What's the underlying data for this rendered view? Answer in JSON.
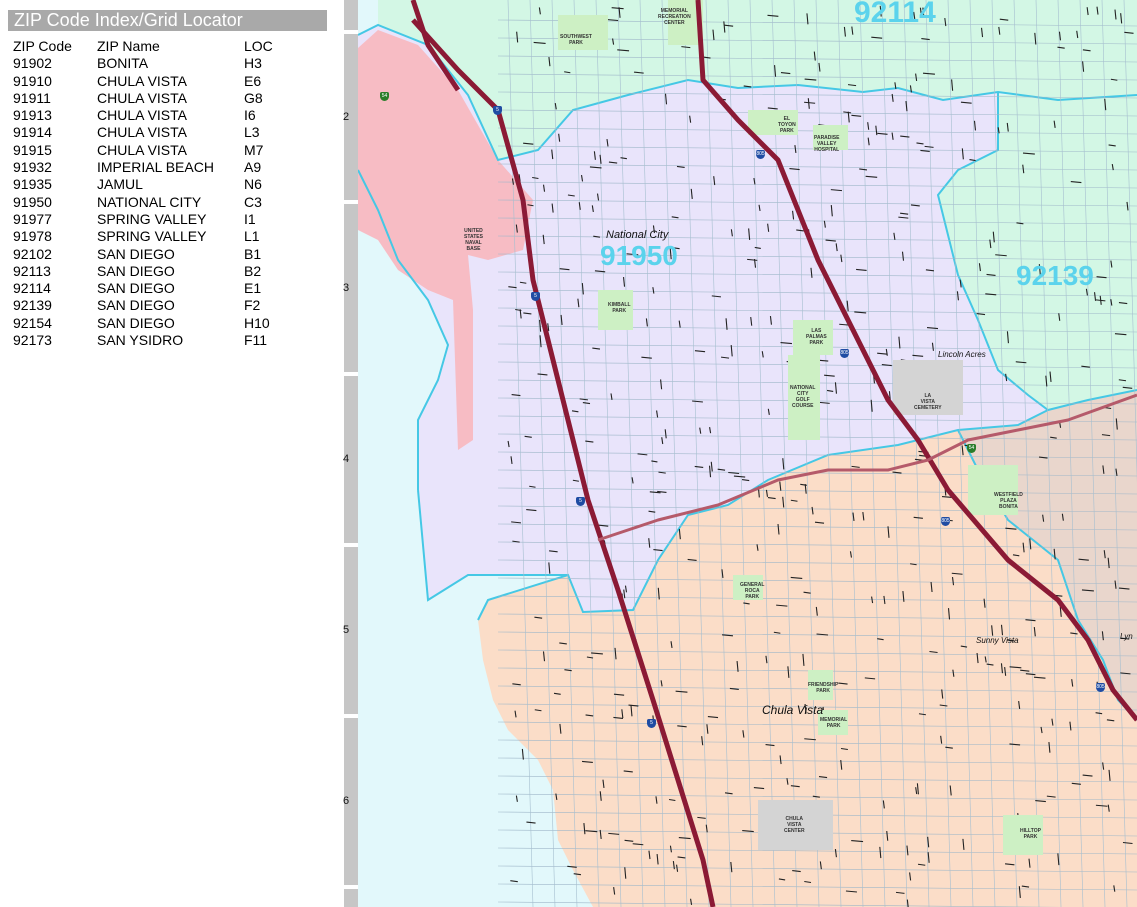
{
  "index": {
    "title": "ZIP Code Index/Grid Locator",
    "headers": [
      "ZIP Code",
      "ZIP Name",
      "LOC"
    ],
    "rows": [
      [
        "91902",
        "BONITA",
        "H3"
      ],
      [
        "91910",
        "CHULA VISTA",
        "E6"
      ],
      [
        "91911",
        "CHULA VISTA",
        "G8"
      ],
      [
        "91913",
        "CHULA VISTA",
        "I6"
      ],
      [
        "91914",
        "CHULA VISTA",
        "L3"
      ],
      [
        "91915",
        "CHULA VISTA",
        "M7"
      ],
      [
        "91932",
        "IMPERIAL BEACH",
        "A9"
      ],
      [
        "91935",
        "JAMUL",
        "N6"
      ],
      [
        "91950",
        "NATIONAL CITY",
        "C3"
      ],
      [
        "91977",
        "SPRING VALLEY",
        "I1"
      ],
      [
        "91978",
        "SPRING VALLEY",
        "L1"
      ],
      [
        "92102",
        "SAN DIEGO",
        "B1"
      ],
      [
        "92113",
        "SAN DIEGO",
        "B2"
      ],
      [
        "92114",
        "SAN DIEGO",
        "E1"
      ],
      [
        "92139",
        "SAN DIEGO",
        "F2"
      ],
      [
        "92154",
        "SAN DIEGO",
        "H10"
      ],
      [
        "92173",
        "SAN YSIDRO",
        "F11"
      ]
    ]
  },
  "grid_rows": [
    "2",
    "3",
    "4",
    "5",
    "6"
  ],
  "map": {
    "zip_labels": [
      "92114",
      "91950",
      "92139"
    ],
    "places": [
      "National City",
      "Lincoln Acres",
      "Sunny Vista",
      "Chula Vista",
      "Lyn"
    ],
    "parks": [
      "SOUTHWEST PARK",
      "MEMORIAL RECREATION CENTER",
      "PARADISE VALLEY HOSPITAL",
      "EL TOYON PARK",
      "UNITED STATES NAVAL BASE",
      "KIMBALL PARK",
      "LAS PALMAS PARK",
      "NATIONAL CITY GOLF COURSE",
      "LA VISTA CEMETERY",
      "WESTFIELD PLAZA BONITA",
      "GENERAL ROCA PARK",
      "FRIENDSHIP PARK",
      "MEMORIAL PARK",
      "CHULA VISTA CENTER",
      "HILLTOP PARK"
    ],
    "shields": [
      "5",
      "805",
      "54",
      "15",
      "5",
      "805",
      "54",
      "805",
      "5",
      "805",
      "5"
    ],
    "colors": {
      "water": "#e2f8fb",
      "zip_92114": "#d3f7e5",
      "zip_91950": "#e9e4fb",
      "zip_91910": "#fbddc8",
      "navy_base": "#f7bcc4",
      "zip_91902": "#e9d6cc",
      "park": "#cdf0c4",
      "cemetery": "#d4d4d4",
      "zip_boundary": "#45c8e5",
      "freeway": "#8b1a35",
      "zip_label": "#5bd3ec"
    }
  }
}
